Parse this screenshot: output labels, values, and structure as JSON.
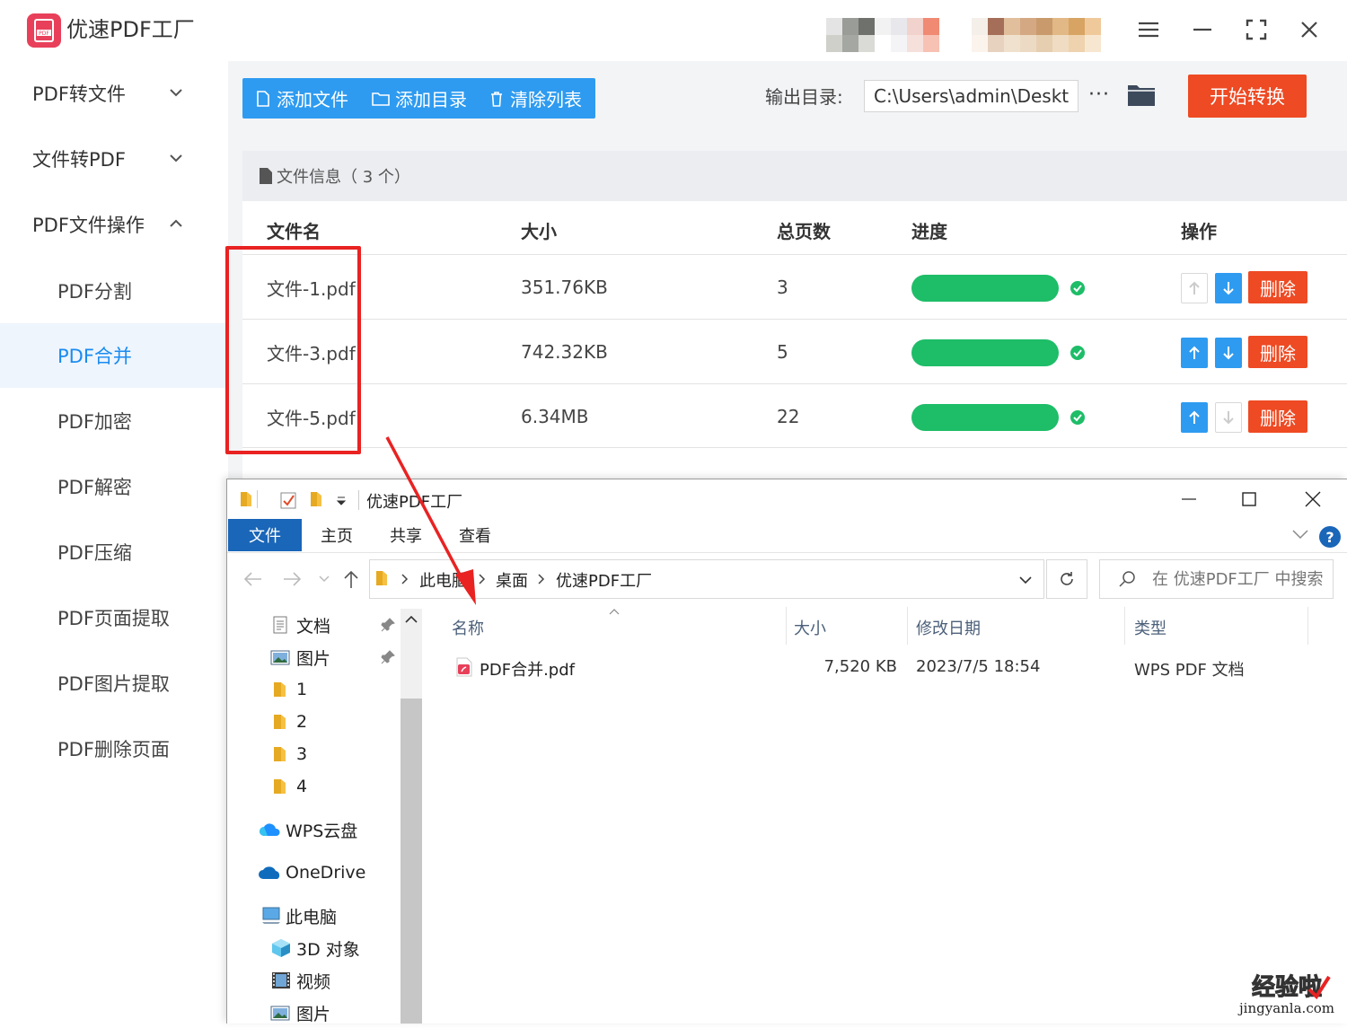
{
  "app": {
    "title": "优速PDF工厂",
    "logo_text": "PDF",
    "accent_color": "#2e9bf0",
    "danger_color": "#ee4a23",
    "success_color": "#1ebd68"
  },
  "sidebar": {
    "groups": [
      {
        "label": "PDF转文件",
        "expanded": false
      },
      {
        "label": "文件转PDF",
        "expanded": false
      },
      {
        "label": "PDF文件操作",
        "expanded": true
      }
    ],
    "items": [
      {
        "label": "PDF分割",
        "active": false
      },
      {
        "label": "PDF合并",
        "active": true
      },
      {
        "label": "PDF加密",
        "active": false
      },
      {
        "label": "PDF解密",
        "active": false
      },
      {
        "label": "PDF压缩",
        "active": false
      },
      {
        "label": "PDF页面提取",
        "active": false
      },
      {
        "label": "PDF图片提取",
        "active": false
      },
      {
        "label": "PDF删除页面",
        "active": false
      }
    ]
  },
  "toolbar": {
    "add_file": "添加文件",
    "add_folder": "添加目录",
    "clear_list": "清除列表",
    "output_label": "输出目录:",
    "output_path": "C:\\Users\\admin\\Deskto",
    "more": "···",
    "start": "开始转换"
  },
  "file_info": {
    "label": "文件信息（ 3 个）"
  },
  "table": {
    "headers": [
      "文件名",
      "大小",
      "总页数",
      "进度",
      "操作"
    ],
    "delete_label": "删除",
    "rows": [
      {
        "name": "文件-1.pdf",
        "size": "351.76KB",
        "pages": "3",
        "progress": 1.0,
        "up_enabled": false,
        "down_enabled": true
      },
      {
        "name": "文件-3.pdf",
        "size": "742.32KB",
        "pages": "5",
        "progress": 1.0,
        "up_enabled": true,
        "down_enabled": true
      },
      {
        "name": "文件-5.pdf",
        "size": "6.34MB",
        "pages": "22",
        "progress": 1.0,
        "up_enabled": true,
        "down_enabled": false
      }
    ]
  },
  "explorer": {
    "title": "优速PDF工厂",
    "ribbon_tabs": [
      "文件",
      "主页",
      "共享",
      "查看"
    ],
    "breadcrumb": [
      "此电脑",
      "桌面",
      "优速PDF工厂"
    ],
    "search_placeholder": "在 优速PDF工厂 中搜索",
    "nav": [
      {
        "label": "文档",
        "icon": "documents-icon",
        "pinned": true
      },
      {
        "label": "图片",
        "icon": "pictures-icon",
        "pinned": true
      },
      {
        "label": "1",
        "icon": "folder-icon",
        "pinned": false
      },
      {
        "label": "2",
        "icon": "folder-icon",
        "pinned": false
      },
      {
        "label": "3",
        "icon": "folder-icon",
        "pinned": false
      },
      {
        "label": "4",
        "icon": "folder-icon",
        "pinned": false
      },
      {
        "label": "WPS云盘",
        "icon": "cloud-icon",
        "pinned": false
      },
      {
        "label": "OneDrive",
        "icon": "cloud-icon",
        "pinned": false
      },
      {
        "label": "此电脑",
        "icon": "computer-icon",
        "pinned": false
      },
      {
        "label": "3D 对象",
        "icon": "cube-icon",
        "pinned": false
      },
      {
        "label": "视频",
        "icon": "video-icon",
        "pinned": false
      },
      {
        "label": "图片",
        "icon": "pictures-icon",
        "pinned": false
      }
    ],
    "columns": [
      "名称",
      "大小",
      "修改日期",
      "类型"
    ],
    "files": [
      {
        "name": "PDF合并.pdf",
        "size": "7,520 KB",
        "modified": "2023/7/5 18:54",
        "type": "WPS PDF 文档"
      }
    ]
  },
  "watermark": {
    "text": "经验啦",
    "domain": "jingyanla.com"
  }
}
